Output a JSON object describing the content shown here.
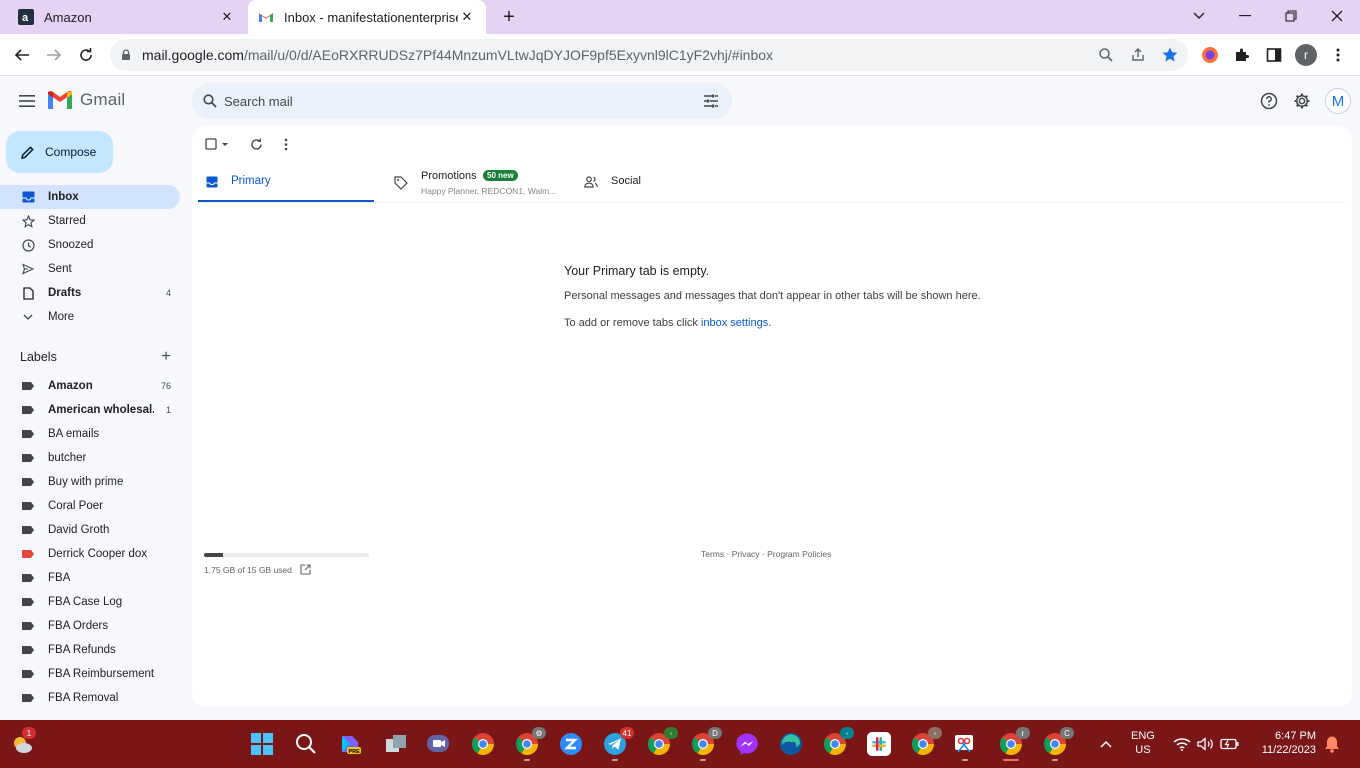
{
  "browser": {
    "tabs": [
      {
        "title": "Amazon"
      },
      {
        "title": "Inbox - manifestationenterprises"
      }
    ],
    "url_host": "mail.google.com",
    "url_path": "/mail/u/0/d/AEoRXRRUDSz7Pf44MnzumVLtwJqDYJOF9pf5Exyvnl9lC1yF2vhj/#inbox",
    "profile_letter": "r"
  },
  "header": {
    "product": "Gmail",
    "search_placeholder": "Search mail",
    "account_initial": "M"
  },
  "sidebar": {
    "compose": "Compose",
    "items": [
      {
        "label": "Inbox",
        "count": ""
      },
      {
        "label": "Starred",
        "count": ""
      },
      {
        "label": "Snoozed",
        "count": ""
      },
      {
        "label": "Sent",
        "count": ""
      },
      {
        "label": "Drafts",
        "count": "4"
      },
      {
        "label": "More",
        "count": ""
      }
    ],
    "labels_heading": "Labels",
    "labels": [
      {
        "name": "Amazon",
        "count": "76"
      },
      {
        "name": "American wholesal...",
        "count": "1"
      },
      {
        "name": "BA emails",
        "count": ""
      },
      {
        "name": "butcher",
        "count": ""
      },
      {
        "name": "Buy with prime",
        "count": ""
      },
      {
        "name": "Coral Poer",
        "count": ""
      },
      {
        "name": "David Groth",
        "count": ""
      },
      {
        "name": "Derrick Cooper dox",
        "count": ""
      },
      {
        "name": "FBA",
        "count": ""
      },
      {
        "name": "FBA Case Log",
        "count": ""
      },
      {
        "name": "FBA Orders",
        "count": ""
      },
      {
        "name": "FBA Refunds",
        "count": ""
      },
      {
        "name": "FBA Reimbursement",
        "count": ""
      },
      {
        "name": "FBA Removal",
        "count": ""
      }
    ],
    "label_colors": {
      "default": "#444746",
      "red": "#e8453c"
    }
  },
  "main": {
    "tabs": {
      "primary": "Primary",
      "promotions": "Promotions",
      "promotions_badge": "50 new",
      "promotions_snippet": "Happy Planner, REDCON1, Walm...",
      "social": "Social"
    },
    "empty_title": "Your Primary tab is empty.",
    "empty_line1": "Personal messages and messages that don't appear in other tabs will be shown here.",
    "empty_line2_prefix": "To add or remove tabs click ",
    "empty_line2_link": "inbox settings",
    "empty_line2_suffix": ".",
    "storage": "1.75 GB of 15 GB used",
    "storage_fraction": 0.117,
    "footer": "Terms · Privacy · Program Policies"
  },
  "taskbar": {
    "weather_badge": "1",
    "telegram_badge": "41",
    "lang": "ENG",
    "region": "US",
    "time": "6:47 PM",
    "date": "11/22/2023"
  },
  "colors": {
    "accent": "#0b57d0",
    "compose_bg": "#c2e7ff",
    "active_nav": "#d3e3fd",
    "badge_green": "#188038",
    "taskbar": "#7a1616",
    "tabstrip": "#e6d3f3"
  }
}
